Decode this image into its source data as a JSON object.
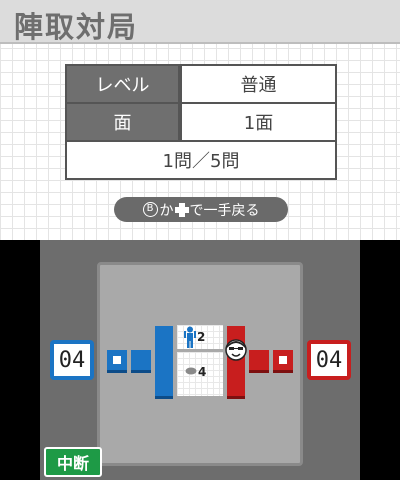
{
  "title": "陣取対局",
  "info": {
    "level_label": "レベル",
    "level_value": "普通",
    "stage_label": "面",
    "stage_value": "1面",
    "question_progress": "1問／5問"
  },
  "undo_hint": {
    "prefix": "Ⓑ",
    "middle": "か",
    "suffix": "で一手戻る"
  },
  "game": {
    "blue_score": "04",
    "red_score": "04",
    "top_lane_count": "2",
    "bottom_lane_count": "4",
    "pause_label": "中断"
  },
  "colors": {
    "blue": "#1b74c4",
    "red": "#c81e1e",
    "pause_green": "#1e9a46"
  },
  "icons": [
    "person-icon",
    "player-face-icon",
    "stone-icon",
    "dpad-icon",
    "b-button-icon"
  ]
}
